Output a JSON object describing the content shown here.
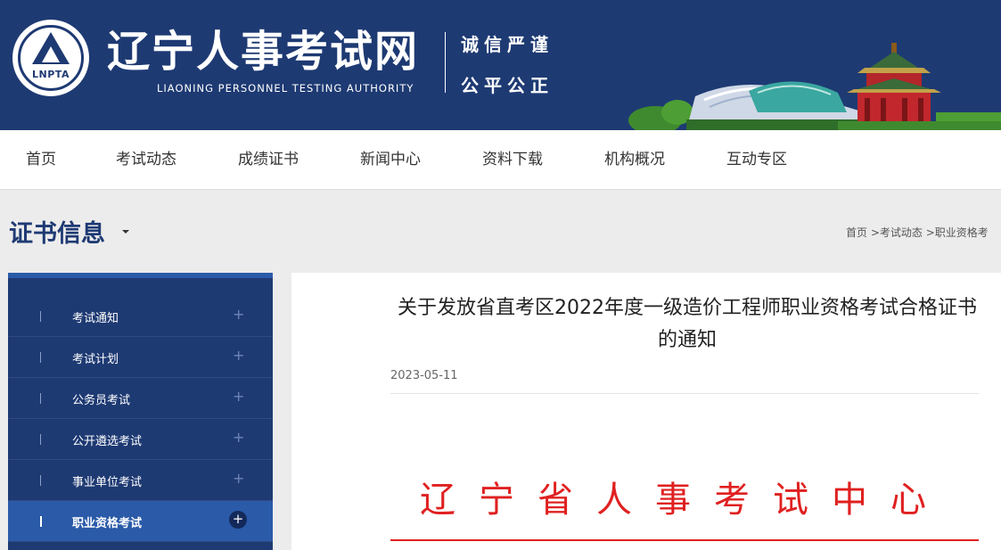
{
  "header": {
    "logo_abbr": "LNPTA",
    "title": "辽宁人事考试网",
    "subtitle": "LIAONING PERSONNEL TESTING AUTHORITY",
    "slogan_line1": "诚信严谨",
    "slogan_line2": "公平公正"
  },
  "nav": {
    "items": [
      "首页",
      "考试动态",
      "成绩证书",
      "新闻中心",
      "资料下载",
      "机构概况",
      "互动专区"
    ]
  },
  "page": {
    "heading": "证书信息",
    "breadcrumb": [
      "首页",
      ">考试动态",
      ">职业资格考"
    ]
  },
  "sidebar": {
    "items": [
      {
        "label": "考试通知",
        "active": false
      },
      {
        "label": "考试计划",
        "active": false
      },
      {
        "label": "公务员考试",
        "active": false
      },
      {
        "label": "公开遴选考试",
        "active": false
      },
      {
        "label": "事业单位考试",
        "active": false
      },
      {
        "label": "职业资格考试",
        "active": true
      }
    ],
    "expand_symbol": "+"
  },
  "article": {
    "title": "关于发放省直考区2022年度一级造价工程师职业资格考试合格证书的通知",
    "date": "2023-05-11",
    "org_header": "辽宁省人事考试中心"
  },
  "colors": {
    "brand_blue": "#1e3a73",
    "active_blue": "#2a5aa8",
    "red": "#e02020"
  }
}
